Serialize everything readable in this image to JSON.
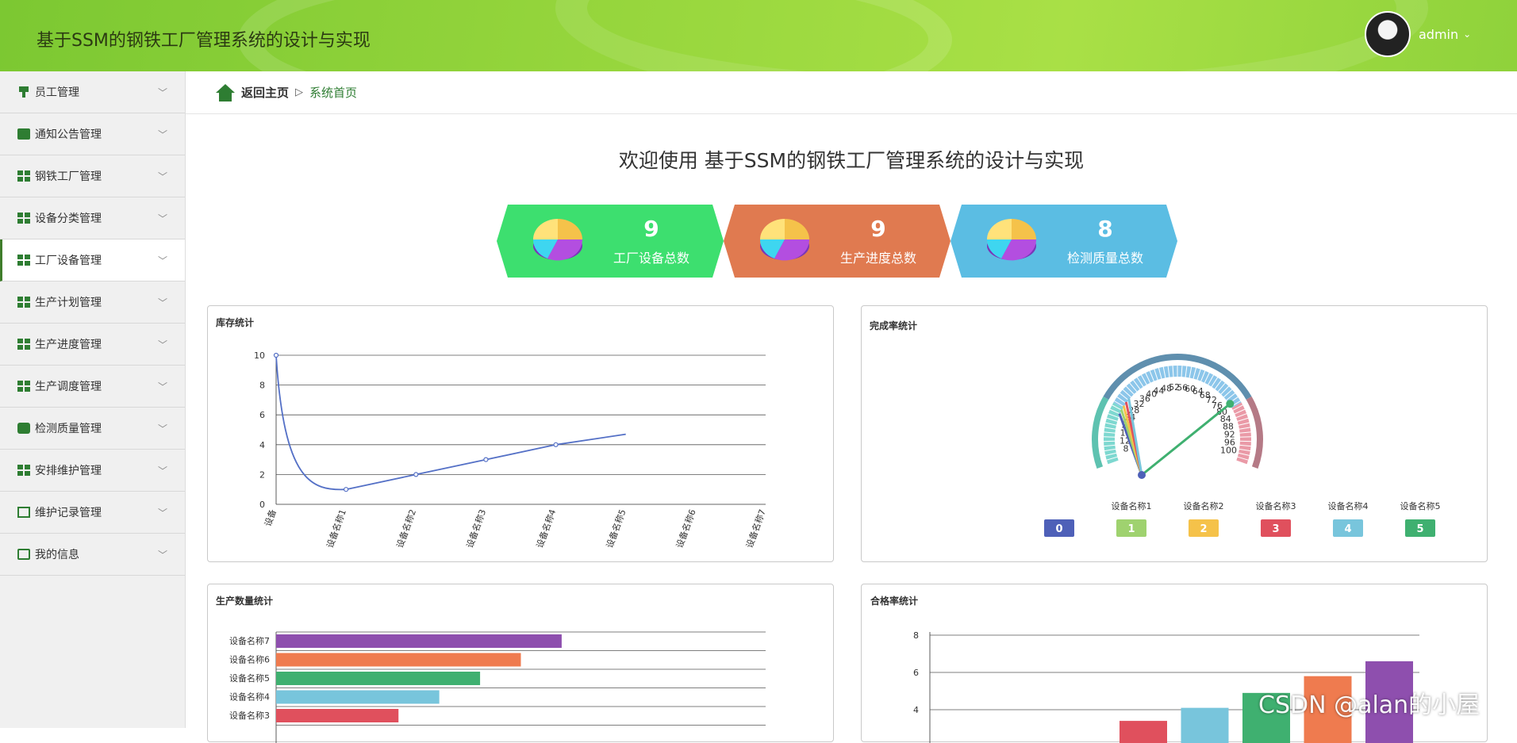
{
  "header": {
    "title": "基于SSM的钢铁工厂管理系统的设计与实现",
    "username": "admin",
    "chevron": "⌄"
  },
  "sidebar": {
    "items": [
      {
        "label": "员工管理",
        "icon": "pin-icon"
      },
      {
        "label": "通知公告管理",
        "icon": "ticket-icon"
      },
      {
        "label": "钢铁工厂管理",
        "icon": "grid-icon"
      },
      {
        "label": "设备分类管理",
        "icon": "grid-icon"
      },
      {
        "label": "工厂设备管理",
        "icon": "grid-icon",
        "active": true
      },
      {
        "label": "生产计划管理",
        "icon": "grid-icon"
      },
      {
        "label": "生产进度管理",
        "icon": "grid-icon"
      },
      {
        "label": "生产调度管理",
        "icon": "grid-icon"
      },
      {
        "label": "检测质量管理",
        "icon": "chat-icon"
      },
      {
        "label": "安排维护管理",
        "icon": "grid-icon"
      },
      {
        "label": "维护记录管理",
        "icon": "trend-icon"
      },
      {
        "label": "我的信息",
        "icon": "card-icon"
      }
    ],
    "arrow": "﹀"
  },
  "breadcrumb": {
    "home": "返回主页",
    "sep": "▷",
    "current": "系统首页"
  },
  "welcome": "欢迎使用 基于SSM的钢铁工厂管理系统的设计与实现",
  "stats": [
    {
      "num": "9",
      "label": "工厂设备总数",
      "color": "#3ddf6f"
    },
    {
      "num": "9",
      "label": "生产进度总数",
      "color": "#e07a50"
    },
    {
      "num": "8",
      "label": "检测质量总数",
      "color": "#5bbde3"
    }
  ],
  "panels": {
    "stock": {
      "title": "库存统计"
    },
    "completion": {
      "title": "完成率统计"
    },
    "production": {
      "title": "生产数量统计"
    },
    "qualified": {
      "title": "合格率统计"
    }
  },
  "watermark": "CSDN @alan的小屋",
  "chart_data": [
    {
      "type": "line",
      "title": "库存统计",
      "categories": [
        "设备",
        "设备名称1",
        "设备名称2",
        "设备名称3",
        "设备名称4",
        "设备名称5",
        "设备名称6",
        "设备名称7"
      ],
      "values": [
        10,
        1,
        2,
        3,
        4,
        4.7
      ],
      "ylim": [
        0,
        10
      ],
      "yticks": [
        0,
        2,
        4,
        6,
        8,
        10
      ]
    },
    {
      "type": "gauge",
      "title": "完成率统计",
      "ticks": [
        100,
        96,
        92,
        88,
        84,
        80,
        76,
        72,
        68,
        64,
        60,
        56,
        52,
        48,
        44,
        40,
        36,
        32,
        28,
        24,
        20,
        16,
        12,
        8
      ],
      "legend_names": [
        "设备名称1",
        "设备名称2",
        "设备名称3",
        "设备名称4",
        "设备名称5"
      ],
      "legend_badges": [
        {
          "label": "0",
          "color": "#4e60b8"
        },
        {
          "label": "1",
          "color": "#9fd26f"
        },
        {
          "label": "2",
          "color": "#f5c24a"
        },
        {
          "label": "3",
          "color": "#e0505d"
        },
        {
          "label": "4",
          "color": "#78c5dc"
        },
        {
          "label": "5",
          "color": "#3fb070"
        }
      ]
    },
    {
      "type": "bar",
      "title": "生产数量统计",
      "orientation": "horizontal",
      "categories": [
        "设备名称7",
        "设备名称6",
        "设备名称5",
        "设备名称4",
        "设备名称3"
      ],
      "values": [
        7,
        6,
        5,
        4,
        3
      ],
      "colors": [
        "#8e4fae",
        "#ef7b4f",
        "#3fb070",
        "#78c5dc",
        "#e0505d"
      ],
      "xlim": [
        0,
        12
      ]
    },
    {
      "type": "bar",
      "title": "合格率统计",
      "orientation": "vertical",
      "yticks": [
        4,
        6,
        8
      ],
      "ylim": [
        0,
        8
      ],
      "values": [
        3.4,
        4.1,
        4.9,
        5.8,
        6.6
      ],
      "colors": [
        "#e0505d",
        "#78c5dc",
        "#3fb070",
        "#ef7b4f",
        "#8e4fae"
      ]
    }
  ]
}
